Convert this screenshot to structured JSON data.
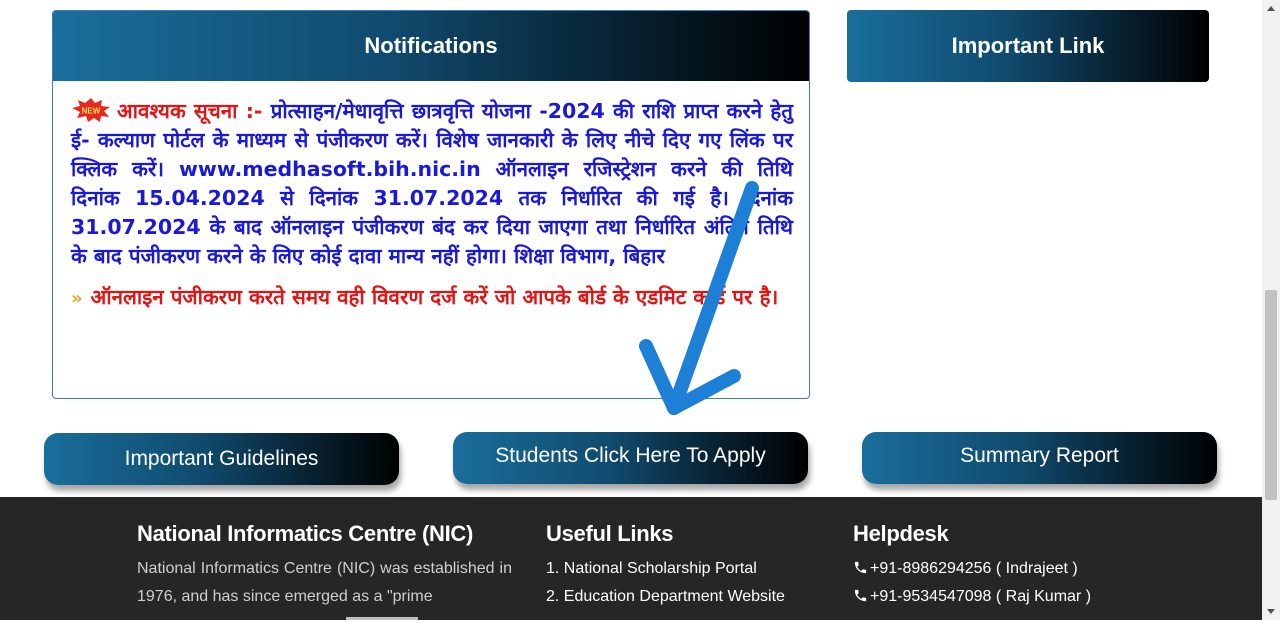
{
  "notifications": {
    "title": "Notifications",
    "new_badge": "NEW",
    "notice_label": "आवश्यक सूचना :-",
    "notice_text": "प्रोत्साहन/मेधावृत्ति छात्रवृत्ति योजना -2024 की राशि प्राप्त करने हेतु ई- कल्याण पोर्टल के माध्यम से पंजीकरण करें। विशेष जानकारी के लिए नीचे दिए गए लिंक पर क्लिक करें। www.medhasoft.bih.nic.in ऑनलाइन रजिस्ट्रेशन करने की तिथि दिनांक 15.04.2024 से दिनांक 31.07.2024 तक निर्धारित की गई है। दिनांक 31.07.2024 के बाद ऑनलाइन पंजीकरण बंद कर दिया जाएगा तथा निर्धारित अंतिम तिथि के बाद पंजीकरण करने के लिए कोई दावा मान्य नहीं होगा। शिक्षा विभाग, बिहार",
    "notice2_text": "ऑनलाइन पंजीकरण करते समय वही विवरण दर्ज करें जो आपके बोर्ड के एडमिट कार्ड पर है।"
  },
  "important_link": {
    "title": "Important Link"
  },
  "buttons": {
    "guidelines": "Important Guidelines",
    "apply": "Students Click Here To Apply",
    "summary": "Summary Report"
  },
  "footer": {
    "nic": {
      "title": "National Informatics Centre (NIC)",
      "text": "National Informatics Centre (NIC) was established in 1976, and has since emerged as a \"prime"
    },
    "useful_links": {
      "title": "Useful Links",
      "items": [
        "1. National Scholarship Portal",
        "2. Education Department Website"
      ]
    },
    "helpdesk": {
      "title": "Helpdesk",
      "phones": [
        "+91-8986294256 ( Indrajeet )",
        "+91-9534547098 ( Raj Kumar )"
      ]
    }
  },
  "colors": {
    "accent_blue": "#1a6e9c",
    "notice_blue": "#1a1ad6",
    "notice_red": "#e01515",
    "arrow": "#1e7fd6",
    "footer_bg": "#262626"
  },
  "icons": [
    "new-badge-icon",
    "double-chevron-icon",
    "phone-icon",
    "annotation-arrow-icon"
  ]
}
